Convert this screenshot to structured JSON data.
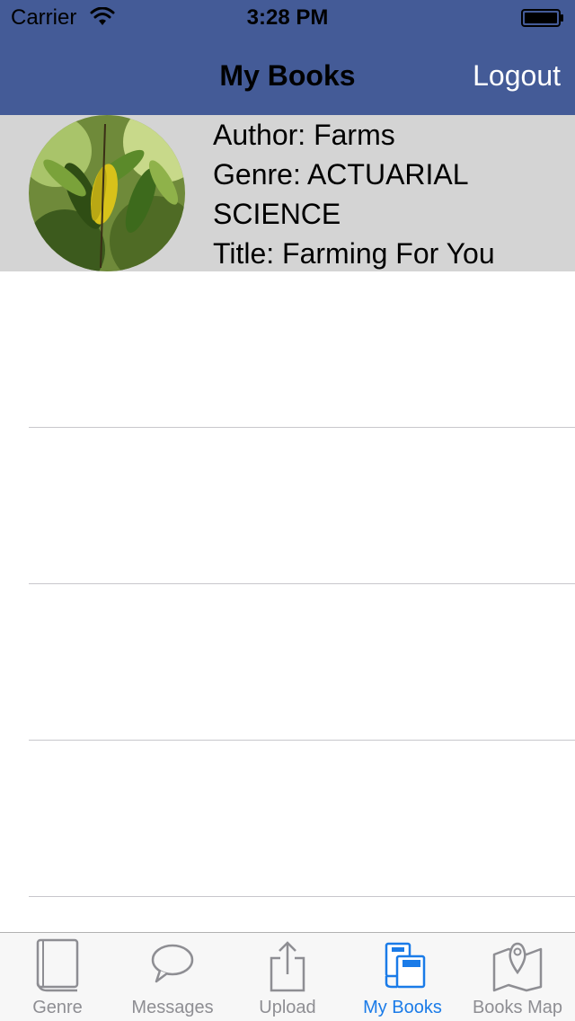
{
  "status_bar": {
    "carrier": "Carrier",
    "time": "3:28 PM"
  },
  "nav": {
    "title": "My Books",
    "logout_label": "Logout"
  },
  "book": {
    "author": "Author: Farms",
    "genre": "Genre: ACTUARIAL SCIENCE",
    "title": "Title: Farming For You",
    "thumbnail_icon": "leaf-photo"
  },
  "tabs": [
    {
      "label": "Genre",
      "icon": "book-icon"
    },
    {
      "label": "Messages",
      "icon": "speech-bubble-icon"
    },
    {
      "label": "Upload",
      "icon": "share-upload-icon"
    },
    {
      "label": "My Books",
      "icon": "books-stack-icon",
      "active": true
    },
    {
      "label": "Books Map",
      "icon": "map-pin-icon"
    }
  ],
  "colors": {
    "nav_background": "#445b97",
    "cell_background": "#d4d4d4",
    "tab_active": "#1a7be8",
    "tab_inactive": "#8e8e93"
  }
}
